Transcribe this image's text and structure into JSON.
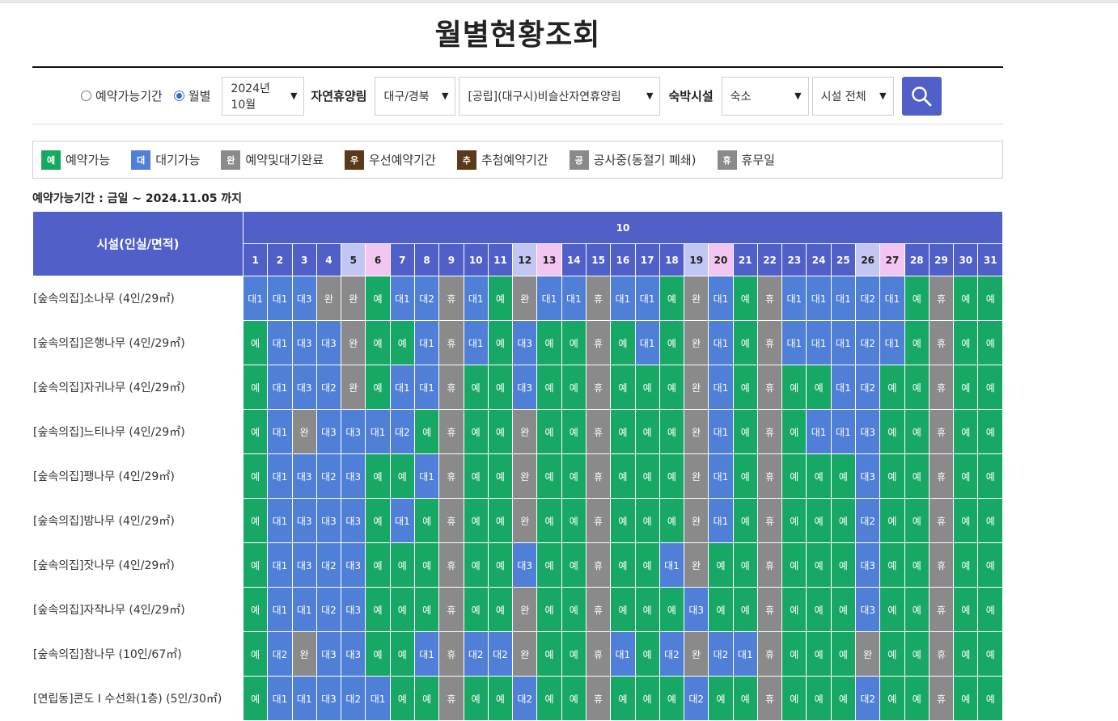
{
  "page": {
    "title": "월별현황조회"
  },
  "filters": {
    "radio_period": "예약가능기간",
    "radio_month": "월별",
    "month_value": "2024년 10월",
    "forest_label": "자연휴양림",
    "region_value": "대구/경북",
    "forest_value": "[공립](대구시)비슬산자연휴양림",
    "lodging_label": "숙박시설",
    "lodging_type_value": "숙소",
    "facility_value": "시설 전체"
  },
  "legend": [
    {
      "badge": "예",
      "label": "예약가능",
      "color": "#18a866"
    },
    {
      "badge": "대",
      "label": "대기가능",
      "color": "#4f7fd6"
    },
    {
      "badge": "완",
      "label": "예약및대기완료",
      "color": "#8a8a8a"
    },
    {
      "badge": "우",
      "label": "우선예약기간",
      "color": "#5a3a1a"
    },
    {
      "badge": "추",
      "label": "추첨예약기간",
      "color": "#5a3a1a"
    },
    {
      "badge": "공",
      "label": "공사중(동절기 폐쇄)",
      "color": "#8a8a8a"
    },
    {
      "badge": "휴",
      "label": "휴무일",
      "color": "#8a8a8a"
    }
  ],
  "period_text": "예약가능기간 : 금일 ~ 2024.11.05 까지",
  "table": {
    "facility_header": "시설(인실/면적)",
    "month": "10",
    "days": [
      "1",
      "2",
      "3",
      "4",
      "5",
      "6",
      "7",
      "8",
      "9",
      "10",
      "11",
      "12",
      "13",
      "14",
      "15",
      "16",
      "17",
      "18",
      "19",
      "20",
      "21",
      "22",
      "23",
      "24",
      "25",
      "26",
      "27",
      "28",
      "29",
      "30",
      "31"
    ],
    "saturdays": [
      5,
      12,
      19,
      26
    ],
    "sundays": [
      6,
      13,
      20,
      27
    ],
    "rows": [
      {
        "name": "[숲속의집]소나무 (4인/29㎡)",
        "cells": [
          "대1",
          "대1",
          "대3",
          "완",
          "완",
          "예",
          "대1",
          "대2",
          "휴",
          "대1",
          "예",
          "완",
          "대1",
          "대1",
          "휴",
          "대1",
          "대1",
          "예",
          "완",
          "대1",
          "예",
          "휴",
          "대1",
          "대1",
          "대1",
          "대2",
          "대1",
          "예",
          "휴",
          "예",
          "예"
        ]
      },
      {
        "name": "[숲속의집]은행나무 (4인/29㎡)",
        "cells": [
          "예",
          "대1",
          "대3",
          "대3",
          "완",
          "예",
          "예",
          "대1",
          "휴",
          "대1",
          "예",
          "대3",
          "예",
          "예",
          "휴",
          "예",
          "대1",
          "예",
          "완",
          "대1",
          "예",
          "휴",
          "대1",
          "대1",
          "대1",
          "대2",
          "대1",
          "예",
          "휴",
          "예",
          "예"
        ]
      },
      {
        "name": "[숲속의집]자귀나무 (4인/29㎡)",
        "cells": [
          "예",
          "대1",
          "대3",
          "대2",
          "완",
          "예",
          "대1",
          "대1",
          "휴",
          "예",
          "예",
          "대3",
          "예",
          "예",
          "휴",
          "예",
          "예",
          "예",
          "완",
          "대1",
          "예",
          "휴",
          "예",
          "예",
          "대1",
          "대2",
          "예",
          "예",
          "휴",
          "예",
          "예"
        ]
      },
      {
        "name": "[숲속의집]느티나무 (4인/29㎡)",
        "cells": [
          "예",
          "대1",
          "완",
          "대3",
          "대3",
          "대1",
          "대2",
          "예",
          "휴",
          "예",
          "예",
          "완",
          "예",
          "예",
          "휴",
          "예",
          "예",
          "예",
          "완",
          "대1",
          "예",
          "휴",
          "예",
          "대1",
          "대1",
          "대3",
          "예",
          "예",
          "휴",
          "예",
          "예"
        ]
      },
      {
        "name": "[숲속의집]팽나무 (4인/29㎡)",
        "cells": [
          "예",
          "대1",
          "대3",
          "대2",
          "대3",
          "예",
          "예",
          "대1",
          "휴",
          "예",
          "예",
          "완",
          "예",
          "예",
          "휴",
          "예",
          "예",
          "예",
          "완",
          "대1",
          "예",
          "휴",
          "예",
          "예",
          "예",
          "대3",
          "예",
          "예",
          "휴",
          "예",
          "예"
        ]
      },
      {
        "name": "[숲속의집]밤나무 (4인/29㎡)",
        "cells": [
          "예",
          "대1",
          "대3",
          "대3",
          "대3",
          "예",
          "대1",
          "예",
          "휴",
          "예",
          "예",
          "완",
          "예",
          "예",
          "휴",
          "예",
          "예",
          "예",
          "완",
          "대1",
          "예",
          "휴",
          "예",
          "예",
          "예",
          "대2",
          "예",
          "예",
          "휴",
          "예",
          "예"
        ]
      },
      {
        "name": "[숲속의집]잣나무 (4인/29㎡)",
        "cells": [
          "예",
          "대1",
          "대3",
          "대2",
          "대3",
          "예",
          "예",
          "예",
          "휴",
          "예",
          "예",
          "대3",
          "예",
          "예",
          "휴",
          "예",
          "예",
          "대1",
          "완",
          "예",
          "예",
          "휴",
          "예",
          "예",
          "예",
          "대3",
          "예",
          "예",
          "휴",
          "예",
          "예"
        ]
      },
      {
        "name": "[숲속의집]자작나무 (4인/29㎡)",
        "cells": [
          "예",
          "대1",
          "대1",
          "대2",
          "대3",
          "예",
          "예",
          "예",
          "휴",
          "예",
          "예",
          "완",
          "예",
          "예",
          "휴",
          "예",
          "예",
          "예",
          "대3",
          "예",
          "예",
          "휴",
          "예",
          "예",
          "예",
          "대3",
          "예",
          "예",
          "휴",
          "예",
          "예"
        ]
      },
      {
        "name": "[숲속의집]참나무 (10인/67㎡)",
        "cells": [
          "예",
          "대2",
          "완",
          "대3",
          "대3",
          "예",
          "예",
          "대1",
          "휴",
          "대2",
          "대2",
          "완",
          "예",
          "예",
          "휴",
          "대1",
          "예",
          "대2",
          "완",
          "대2",
          "대1",
          "휴",
          "예",
          "예",
          "예",
          "완",
          "예",
          "예",
          "휴",
          "예",
          "예"
        ]
      },
      {
        "name": "[연립동]콘도 I 수선화(1층) (5인/30㎡)",
        "cells": [
          "예",
          "대1",
          "대1",
          "대3",
          "대2",
          "대1",
          "예",
          "예",
          "휴",
          "예",
          "예",
          "대2",
          "예",
          "예",
          "휴",
          "예",
          "예",
          "예",
          "대2",
          "예",
          "예",
          "휴",
          "예",
          "예",
          "예",
          "대2",
          "예",
          "예",
          "휴",
          "예",
          "예"
        ]
      }
    ]
  }
}
